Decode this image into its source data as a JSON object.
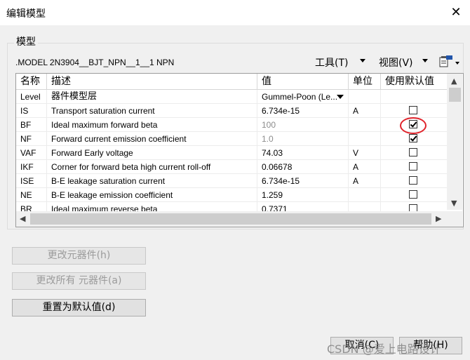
{
  "window": {
    "title": "编辑模型"
  },
  "group": {
    "label": "模型"
  },
  "model_line": ".MODEL 2N3904__BJT_NPN__1__1    NPN",
  "toolbar": {
    "tools": "工具(T)",
    "view": "视图(V)"
  },
  "grid": {
    "headers": [
      "名称",
      "描述",
      "值",
      "单位",
      "使用默认值"
    ],
    "rows": [
      {
        "name": "Level",
        "desc": "器件模型层",
        "value": "Gummel-Poon (Le...",
        "unit": "",
        "checkbox": null
      },
      {
        "name": "IS",
        "desc": "Transport saturation current",
        "value": "6.734e-15",
        "unit": "A",
        "checkbox": false
      },
      {
        "name": "BF",
        "desc": "Ideal maximum forward beta",
        "value": "100",
        "unit": "",
        "checkbox": true,
        "value_gray": true
      },
      {
        "name": "NF",
        "desc": "Forward current emission coefficient",
        "value": "1.0",
        "unit": "",
        "checkbox": true,
        "value_gray": true
      },
      {
        "name": "VAF",
        "desc": "Forward Early voltage",
        "value": "74.03",
        "unit": "V",
        "checkbox": false
      },
      {
        "name": "IKF",
        "desc": "Corner for forward beta high current roll-off",
        "value": "0.06678",
        "unit": "A",
        "checkbox": false
      },
      {
        "name": "ISE",
        "desc": "B-E leakage saturation current",
        "value": "6.734e-15",
        "unit": "A",
        "checkbox": false
      },
      {
        "name": "NE",
        "desc": "B-E leakage emission coefficient",
        "value": "1.259",
        "unit": "",
        "checkbox": false
      },
      {
        "name": "BR",
        "desc": "Ideal maximum reverse beta",
        "value": "0.7371",
        "unit": "",
        "checkbox": false
      }
    ]
  },
  "buttons": {
    "change_component": "更改元器件(h)",
    "change_all": "更改所有 元器件(a)",
    "reset_default": "重置为默认值(d)",
    "cancel": "取消(C)",
    "help": "帮助(H)"
  },
  "watermark": "CSDN @爱上电路设计"
}
